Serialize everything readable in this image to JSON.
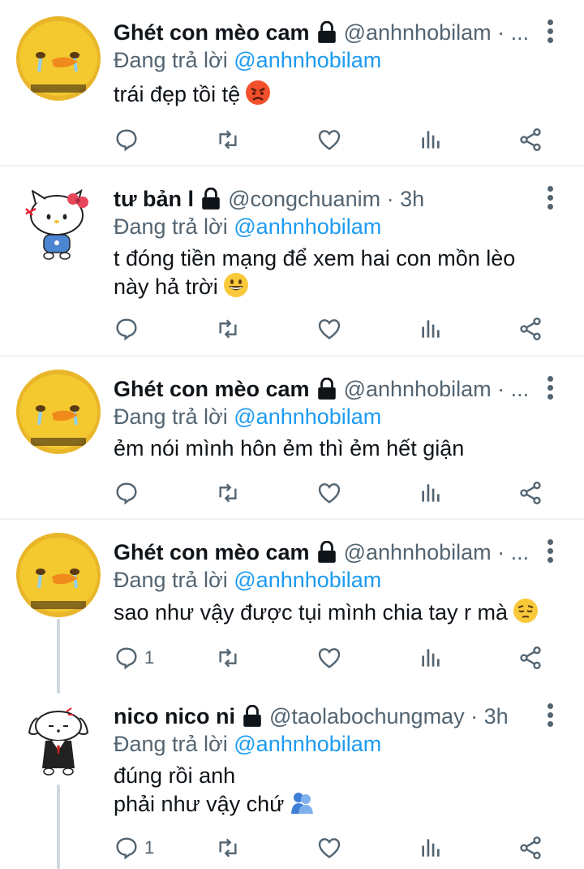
{
  "tweets": [
    {
      "name": "Ghét con mèo cam",
      "handle_line": "@anhnhobilam · ...",
      "replying_prefix": "Đang trả lời ",
      "replying_to": "@anhnhobilam",
      "content_lines": [
        "trái đẹp tồi tệ"
      ],
      "emoji": "angry-face",
      "reply_count": "",
      "avatar": "yellow-duck-crying"
    },
    {
      "name": "tư bản l",
      "handle_line": "@congchuanim · 3h",
      "replying_prefix": "Đang trả lời ",
      "replying_to": "@anhnhobilam",
      "content_lines": [
        "t đóng tiền mạng để xem hai con mồn lèo",
        "này hả trời"
      ],
      "emoji": "grinning-face",
      "reply_count": "",
      "avatar": "hello-kitty-angry"
    },
    {
      "name": "Ghét con mèo cam",
      "handle_line": "@anhnhobilam · ...",
      "replying_prefix": "Đang trả lời ",
      "replying_to": "@anhnhobilam",
      "content_lines": [
        "ẻm nói mình hôn ẻm thì ẻm hết giận"
      ],
      "emoji": "",
      "reply_count": "",
      "avatar": "yellow-duck-crying"
    },
    {
      "name": "Ghét con mèo cam",
      "handle_line": "@anhnhobilam · ...",
      "replying_prefix": "Đang trả lời ",
      "replying_to": "@anhnhobilam",
      "content_lines": [
        "sao như vậy được tụi mình chia tay r mà"
      ],
      "emoji": "pensive-face",
      "reply_count": "1",
      "avatar": "yellow-duck-crying"
    },
    {
      "name": "nico nico ni",
      "handle_line": "@taolabochungmay · 3h",
      "replying_prefix": "Đang trả lời ",
      "replying_to": "@anhnhobilam",
      "content_lines": [
        "đúng rồi anh",
        "phải như vậy chứ"
      ],
      "emoji": "people-hugging",
      "reply_count": "1",
      "avatar": "white-puppy-sketch"
    }
  ],
  "icons": {
    "reply": "reply-icon",
    "retweet": "retweet-icon",
    "like": "heart-icon",
    "views": "views-icon",
    "share": "share-icon",
    "lock": "lock-icon",
    "more": "more-vertical-icon"
  },
  "colors": {
    "text": "#0f1419",
    "secondary": "#536471",
    "link": "#1d9bf0",
    "divider": "#eff3f4",
    "thread_line": "#cfd9de"
  }
}
